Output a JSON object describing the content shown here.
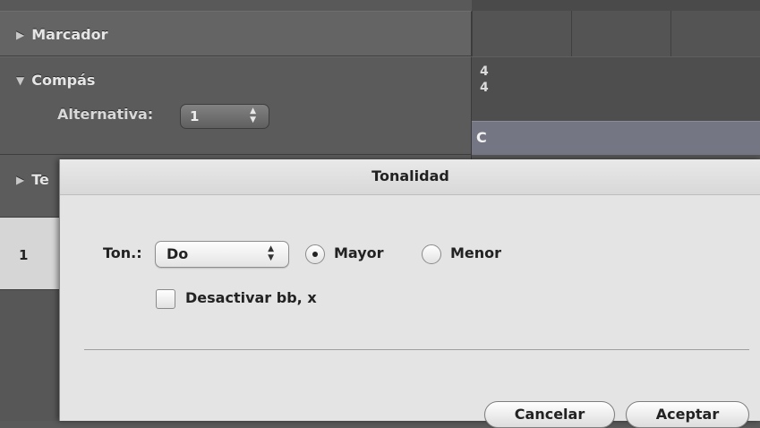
{
  "tracks": {
    "marker_label": "Marcador",
    "meter_label": "Compás",
    "tempo_label_partial": "Te",
    "alternative_label": "Alternativa:",
    "alternative_value": "1",
    "track_number": "1"
  },
  "timeline": {
    "time_signature_top": "4",
    "time_signature_bottom": "4",
    "key_label": "C"
  },
  "dialog": {
    "title": "Tonalidad",
    "key_label": "Ton.:",
    "key_value": "Do",
    "mode_major_label": "Mayor",
    "mode_minor_label": "Menor",
    "mode_selected": "Mayor",
    "disable_checkbox_label": "Desactivar bb, x",
    "disable_checked": false,
    "cancel_label": "Cancelar",
    "ok_label": "Aceptar"
  },
  "icons": {
    "collapsed": "disclosure-triangle-right-icon",
    "expanded": "disclosure-triangle-down-icon",
    "stepper": "stepper-arrows-icon"
  }
}
